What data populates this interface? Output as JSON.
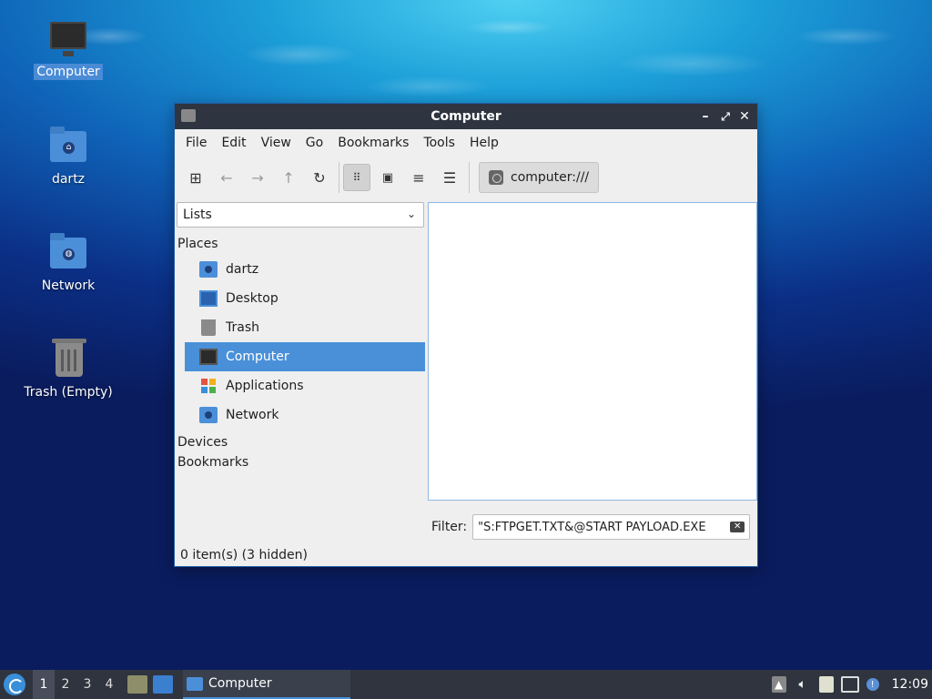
{
  "desktop": {
    "icons": [
      {
        "label": "Computer"
      },
      {
        "label": "dartz"
      },
      {
        "label": "Network"
      },
      {
        "label": "Trash (Empty)"
      }
    ]
  },
  "window": {
    "title": "Computer",
    "controls": {
      "minimize": "–",
      "maximize": "⤢",
      "close": "✕"
    },
    "menu": [
      "File",
      "Edit",
      "View",
      "Go",
      "Bookmarks",
      "Tools",
      "Help"
    ],
    "location": "computer:///",
    "side_pane": {
      "selector_value": "Lists",
      "places_header": "Places",
      "places": [
        {
          "label": "dartz"
        },
        {
          "label": "Desktop"
        },
        {
          "label": "Trash"
        },
        {
          "label": "Computer",
          "selected": true
        },
        {
          "label": "Applications"
        },
        {
          "label": "Network"
        }
      ],
      "devices_header": "Devices",
      "bookmarks_header": "Bookmarks"
    },
    "filter": {
      "label": "Filter:",
      "value": "S:FTPGET.TXT&@START PAYLOAD.EXE\""
    },
    "status": "0 item(s) (3 hidden)"
  },
  "taskbar": {
    "workspaces": [
      "1",
      "2",
      "3",
      "4"
    ],
    "current_workspace": "1",
    "task_label": "Computer",
    "clock": "12:09"
  },
  "colors": {
    "accent": "#4a90d9",
    "titlebar": "#2e3440",
    "taskbar": "#2f343f"
  }
}
